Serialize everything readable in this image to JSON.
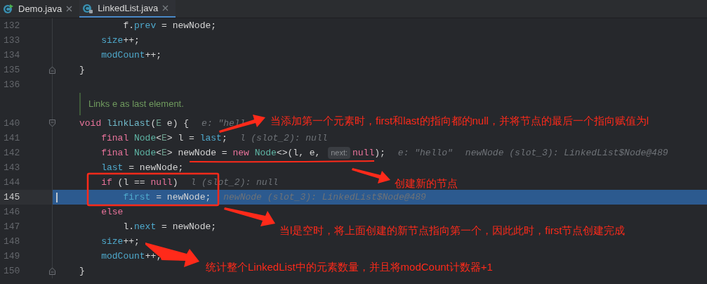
{
  "tabs": [
    {
      "label": "Demo.java",
      "selected": false,
      "runnable": true
    },
    {
      "label": "LinkedList.java",
      "selected": true,
      "runnable": false
    }
  ],
  "lines": [
    {
      "number": "132",
      "kind": "code",
      "current": false,
      "tokens": [
        {
          "kind": "plain",
          "text": "        f."
        },
        {
          "kind": "field",
          "text": "prev"
        },
        {
          "kind": "plain",
          "text": " = newNode;"
        }
      ]
    },
    {
      "number": "133",
      "kind": "code",
      "current": false,
      "tokens": [
        {
          "kind": "field",
          "text": "    size"
        },
        {
          "kind": "plain",
          "text": "++;"
        }
      ]
    },
    {
      "number": "134",
      "kind": "code",
      "current": false,
      "tokens": [
        {
          "kind": "field",
          "text": "    modCount"
        },
        {
          "kind": "plain",
          "text": "++;"
        }
      ]
    },
    {
      "number": "135",
      "kind": "close",
      "current": false,
      "tokens": [
        {
          "kind": "plain",
          "text": "}"
        }
      ]
    },
    {
      "number": "136",
      "kind": "code",
      "current": false
    },
    {
      "kind": "doc",
      "text": "Links e as last element."
    },
    {
      "number": "140",
      "kind": "open",
      "current": false,
      "tokens": [
        {
          "kind": "kw",
          "text": "void "
        },
        {
          "kind": "method",
          "text": "linkLast"
        },
        {
          "kind": "plain",
          "text": "("
        },
        {
          "kind": "typeparam",
          "text": "E"
        },
        {
          "kind": "plain",
          "text": " e) {"
        },
        {
          "kind": "hint",
          "text": "e: \"hell"
        }
      ]
    },
    {
      "number": "141",
      "kind": "code",
      "current": false,
      "tokens": [
        {
          "kind": "kw",
          "text": "    final "
        },
        {
          "kind": "type",
          "text": "Node"
        },
        {
          "kind": "plain",
          "text": "<"
        },
        {
          "kind": "typeparam",
          "text": "E"
        },
        {
          "kind": "plain",
          "text": "> l = "
        },
        {
          "kind": "field",
          "text": "last"
        },
        {
          "kind": "plain",
          "text": ";"
        },
        {
          "kind": "hint",
          "text": "l (slot_2): null"
        }
      ]
    },
    {
      "number": "142",
      "kind": "code",
      "current": false,
      "tokens": [
        {
          "kind": "kw",
          "text": "    final "
        },
        {
          "kind": "type",
          "text": "Node"
        },
        {
          "kind": "plain",
          "text": "<"
        },
        {
          "kind": "typeparam",
          "text": "E"
        },
        {
          "kind": "plain",
          "text": "> newNode = "
        },
        {
          "kind": "kw",
          "text": "new "
        },
        {
          "kind": "type",
          "text": "Node"
        },
        {
          "kind": "plain",
          "text": "<>(l, e, "
        },
        {
          "kind": "inlay",
          "text": "next:"
        },
        {
          "kind": "kw",
          "text": "null"
        },
        {
          "kind": "plain",
          "text": ");"
        },
        {
          "kind": "hint",
          "text": "e: \"hello\""
        },
        {
          "kind": "hint",
          "text": "newNode (slot_3): LinkedList$Node@489"
        }
      ]
    },
    {
      "number": "143",
      "kind": "code",
      "current": false,
      "tokens": [
        {
          "kind": "field",
          "text": "    last"
        },
        {
          "kind": "plain",
          "text": " = newNode;"
        }
      ]
    },
    {
      "number": "144",
      "kind": "code",
      "current": false,
      "tokens": [
        {
          "kind": "kw",
          "text": "    if "
        },
        {
          "kind": "plain",
          "text": "(l == "
        },
        {
          "kind": "kw",
          "text": "null"
        },
        {
          "kind": "plain",
          "text": ")"
        },
        {
          "kind": "hint",
          "text": "l (slot_2): null"
        }
      ]
    },
    {
      "number": "145",
      "kind": "code",
      "current": true,
      "tokens": [
        {
          "kind": "field",
          "text": "        first"
        },
        {
          "kind": "plain",
          "text": " = newNode;"
        },
        {
          "kind": "hint",
          "text": "newNode (slot_3): LinkedList$Node@489"
        }
      ]
    },
    {
      "number": "146",
      "kind": "code",
      "current": false,
      "tokens": [
        {
          "kind": "kw",
          "text": "    else"
        }
      ]
    },
    {
      "number": "147",
      "kind": "code",
      "current": false,
      "tokens": [
        {
          "kind": "plain",
          "text": "        l."
        },
        {
          "kind": "field",
          "text": "next"
        },
        {
          "kind": "plain",
          "text": " = newNode;"
        }
      ]
    },
    {
      "number": "148",
      "kind": "code",
      "current": false,
      "tokens": [
        {
          "kind": "field",
          "text": "    size"
        },
        {
          "kind": "plain",
          "text": "++;"
        }
      ]
    },
    {
      "number": "149",
      "kind": "code",
      "current": false,
      "tokens": [
        {
          "kind": "field",
          "text": "    modCount"
        },
        {
          "kind": "plain",
          "text": "++;"
        }
      ]
    },
    {
      "number": "150",
      "kind": "close",
      "current": false,
      "tokens": [
        {
          "kind": "plain",
          "text": "}"
        }
      ]
    }
  ],
  "annotations": [
    {
      "text": "当添加第一个元素时，first和last的指向都的null，并将节点的最后一个指向赋值为l"
    },
    {
      "text": "创建新的节点"
    },
    {
      "text": "当l是空时，将上面创建的新节点指向第一个，因此此时，first节点创建完成"
    },
    {
      "text": "统计整个LinkedList中的元素数量，并且将modCount计数器+1"
    }
  ]
}
